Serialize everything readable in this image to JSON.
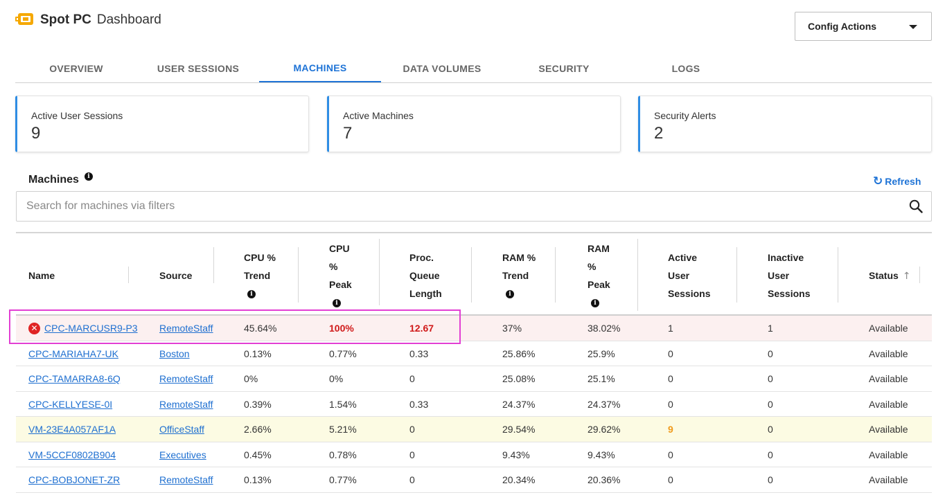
{
  "header": {
    "brand_name": "Spot PC",
    "brand_sub": "Dashboard",
    "config_actions": "Config Actions"
  },
  "tabs": [
    {
      "label": "OVERVIEW"
    },
    {
      "label": "USER SESSIONS"
    },
    {
      "label": "MACHINES",
      "active": true
    },
    {
      "label": "DATA VOLUMES"
    },
    {
      "label": "SECURITY"
    },
    {
      "label": "LOGS"
    }
  ],
  "cards": [
    {
      "label": "Active User Sessions",
      "value": "9"
    },
    {
      "label": "Active Machines",
      "value": "7"
    },
    {
      "label": "Security Alerts",
      "value": "2"
    }
  ],
  "machines": {
    "title": "Machines",
    "refresh_label": "Refresh",
    "search_placeholder": "Search for machines via filters",
    "columns": {
      "name": "Name",
      "source": "Source",
      "cpu_trend": [
        "CPU %",
        "Trend"
      ],
      "cpu_peak": [
        "CPU",
        "%",
        "Peak"
      ],
      "proc_queue": [
        "Proc.",
        "Queue",
        "Length"
      ],
      "ram_trend": [
        "RAM %",
        "Trend"
      ],
      "ram_peak": [
        "RAM",
        "%",
        "Peak"
      ],
      "active_sessions": [
        "Active",
        "User",
        "Sessions"
      ],
      "inactive_sessions": [
        "Inactive",
        "User",
        "Sessions"
      ],
      "status": "Status"
    },
    "rows": [
      {
        "name": "CPC-MARCUSR9-P3",
        "source": "RemoteStaff",
        "cpu_trend": "45.64%",
        "cpu_peak": "100%",
        "proc_queue": "12.67",
        "ram_trend": "37%",
        "ram_peak": "38.02%",
        "active": "1",
        "inactive": "1",
        "status": "Available"
      },
      {
        "name": "CPC-MARIAHA7-UK",
        "source": "Boston",
        "cpu_trend": "0.13%",
        "cpu_peak": "0.77%",
        "proc_queue": "0.33",
        "ram_trend": "25.86%",
        "ram_peak": "25.9%",
        "active": "0",
        "inactive": "0",
        "status": "Available"
      },
      {
        "name": "CPC-TAMARRA8-6Q",
        "source": "RemoteStaff",
        "cpu_trend": "0%",
        "cpu_peak": "0%",
        "proc_queue": "0",
        "ram_trend": "25.08%",
        "ram_peak": "25.1%",
        "active": "0",
        "inactive": "0",
        "status": "Available"
      },
      {
        "name": "CPC-KELLYESE-0I",
        "source": "RemoteStaff",
        "cpu_trend": "0.39%",
        "cpu_peak": "1.54%",
        "proc_queue": "0.33",
        "ram_trend": "24.37%",
        "ram_peak": "24.37%",
        "active": "0",
        "inactive": "0",
        "status": "Available"
      },
      {
        "name": "VM-23E4A057AF1A",
        "source": "OfficeStaff",
        "cpu_trend": "2.66%",
        "cpu_peak": "5.21%",
        "proc_queue": "0",
        "ram_trend": "29.54%",
        "ram_peak": "29.62%",
        "active": "9",
        "inactive": "0",
        "status": "Available"
      },
      {
        "name": "VM-5CCF0802B904",
        "source": "Executives",
        "cpu_trend": "0.45%",
        "cpu_peak": "0.78%",
        "proc_queue": "0",
        "ram_trend": "9.43%",
        "ram_peak": "9.43%",
        "active": "0",
        "inactive": "0",
        "status": "Available"
      },
      {
        "name": "CPC-BOBJONET-ZR",
        "source": "RemoteStaff",
        "cpu_trend": "0.13%",
        "cpu_peak": "0.77%",
        "proc_queue": "0",
        "ram_trend": "20.34%",
        "ram_peak": "20.36%",
        "active": "0",
        "inactive": "0",
        "status": "Available"
      }
    ]
  },
  "colors": {
    "accent": "#1e73d6",
    "alert_red": "#d01919",
    "warn_orange": "#f09a1b",
    "logo_yellow": "#f5a800",
    "highlight_magenta": "#e23fd3"
  }
}
